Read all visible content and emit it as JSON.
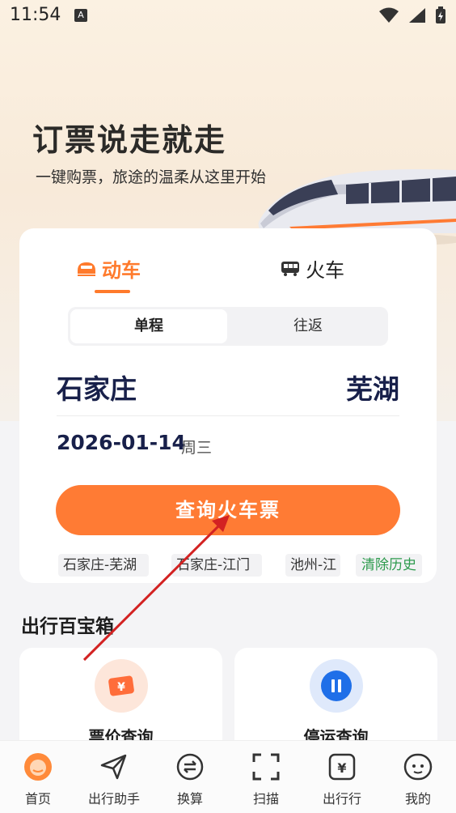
{
  "status_bar": {
    "time": "11:54",
    "notification_badge": "A"
  },
  "hero": {
    "title": "订票说走就走",
    "subtitle": "一键购票，旅途的温柔从这里开始"
  },
  "booking": {
    "tabs": [
      {
        "label": "动车",
        "active": true,
        "icon": "bullet-train-icon"
      },
      {
        "label": "火车",
        "active": false,
        "icon": "train-icon"
      }
    ],
    "trip_types": {
      "one_way": "单程",
      "round_trip": "往返",
      "selected": "单程"
    },
    "from_city": "石家庄",
    "to_city": "芜湖",
    "date": "2026-01-14",
    "weekday": "周三",
    "search_button": "查询火车票",
    "history": [
      "石家庄-芜湖",
      "石家庄-江门",
      "池州-江"
    ],
    "clear_history": "清除历史"
  },
  "toolbox": {
    "title": "出行百宝箱",
    "items": [
      {
        "label": "票价查询",
        "icon": "ticket-price-icon"
      },
      {
        "label": "停运查询",
        "icon": "pause-icon"
      }
    ]
  },
  "bottom_nav": [
    {
      "label": "首页",
      "icon": "home-icon",
      "active": true
    },
    {
      "label": "出行助手",
      "icon": "paper-plane-icon",
      "active": false
    },
    {
      "label": "换算",
      "icon": "exchange-icon",
      "active": false
    },
    {
      "label": "扫描",
      "icon": "scan-icon",
      "active": false
    },
    {
      "label": "出行行",
      "icon": "yen-card-icon",
      "active": false
    },
    {
      "label": "我的",
      "icon": "profile-icon",
      "active": false
    }
  ],
  "colors": {
    "accent": "#ff7b34",
    "city_text": "#18204a",
    "clear_history_green": "#2e9b4e",
    "annotation_arrow": "#d32222"
  }
}
